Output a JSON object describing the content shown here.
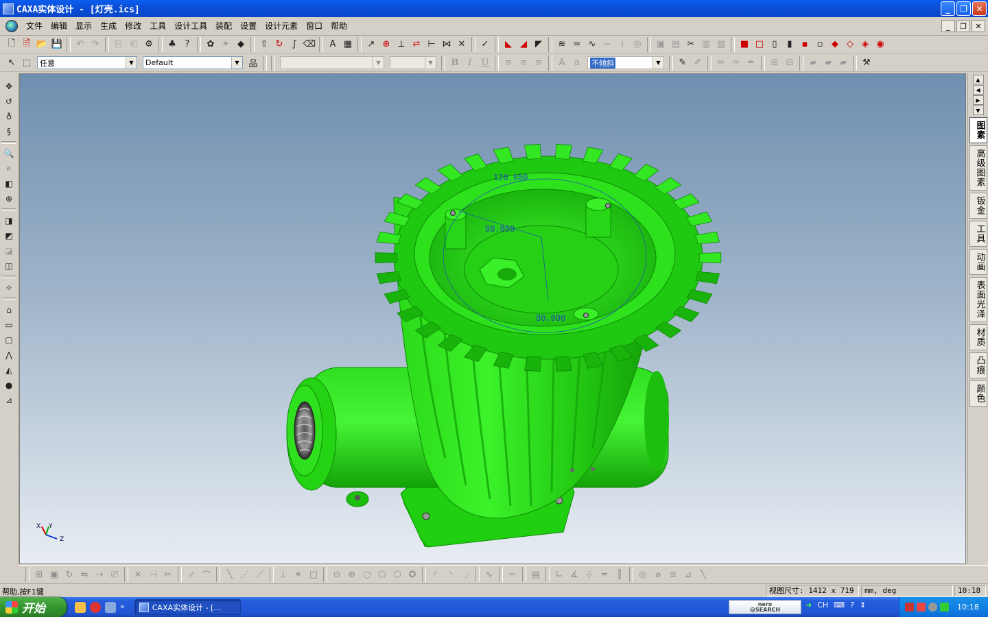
{
  "window": {
    "title": "CAXA实体设计 - [灯壳.ics]",
    "buttons": {
      "minimize": "_",
      "maximize": "❐",
      "close": "✕"
    }
  },
  "menu": {
    "items": [
      "文件",
      "编辑",
      "显示",
      "生成",
      "修改",
      "工具",
      "设计工具",
      "装配",
      "设置",
      "设计元素",
      "窗口",
      "帮助"
    ]
  },
  "toolbar2": {
    "select_filter": "任意",
    "style_combo": "Default",
    "font_combo": "",
    "size_combo": "",
    "bold": "B",
    "italic": "I",
    "underline": "U",
    "tilt_combo": "不倾斜"
  },
  "viewport": {
    "dim_labels": [
      "120.000",
      "80.000",
      "80.000"
    ],
    "axis_labels": {
      "x": "X",
      "y": "Y",
      "z": "Z"
    },
    "colors": {
      "part": "#22dd11",
      "part_dark": "#12a008",
      "dimension": "#2255aa"
    }
  },
  "right_panel": {
    "tabs": [
      "图素",
      "高级图素",
      "钣金",
      "工具",
      "动画",
      "表面光泽",
      "材质",
      "凸痕",
      "颜色"
    ],
    "active_tab": "图素"
  },
  "status": {
    "help": "帮助,按F1键",
    "view_size": "视图尺寸: 1412 x  719",
    "units": "mm, deg",
    "time": "10:18"
  },
  "taskbar": {
    "start": "开始",
    "task_label": "CAXA实体设计 - [...",
    "nero_top": "nero",
    "nero_bottom": "@SEARCH",
    "lang": "CH",
    "clock": "10:18"
  }
}
